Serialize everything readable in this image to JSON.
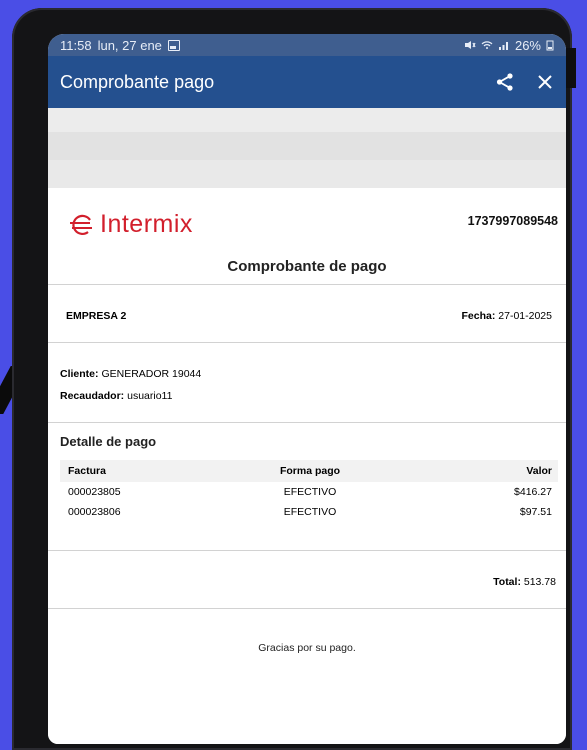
{
  "status_bar": {
    "time": "11:58",
    "date": "lun, 27 ene",
    "battery": "26%"
  },
  "app_bar": {
    "title": "Comprobante pago",
    "share_icon": "share-icon",
    "close_icon": "close-icon"
  },
  "receipt": {
    "logo_text": "Intermix",
    "number": "1737997089548",
    "title": "Comprobante de pago",
    "company": "EMPRESA 2",
    "date_label": "Fecha:",
    "date_value": "27-01-2025",
    "client_label": "Cliente:",
    "client_value": "GENERADOR 19044",
    "collector_label": "Recaudador:",
    "collector_value": "usuario11",
    "detail_title": "Detalle de pago",
    "table": {
      "headers": [
        "Factura",
        "Forma pago",
        "Valor"
      ],
      "rows": [
        [
          "000023805",
          "EFECTIVO",
          "$416.27"
        ],
        [
          "000023806",
          "EFECTIVO",
          "$97.51"
        ]
      ]
    },
    "total_label": "Total:",
    "total_value": "513.78",
    "thanks": "Gracias por su pago."
  },
  "colors": {
    "background": "#4a4ee6",
    "app_bar": "#24508f",
    "status_bar": "#3f5e8f",
    "logo": "#d21f2c"
  }
}
